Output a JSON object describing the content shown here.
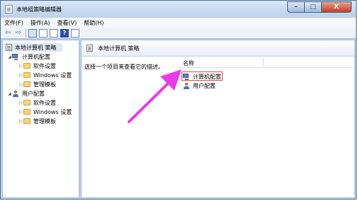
{
  "window": {
    "title": "本地组策略编辑器",
    "controls": {
      "minimize": "–",
      "maximize": "□",
      "close": "X"
    }
  },
  "menu": [
    "文件(F)",
    "操作(A)",
    "查看(V)",
    "帮助(H)"
  ],
  "toolbar": {
    "buttons": [
      "back-arrow-icon",
      "forward-arrow-icon",
      "show-tree-icon",
      "properties-icon",
      "export-icon",
      "help-icon",
      "view-icon"
    ],
    "back_glyph": "⇦",
    "forward_glyph": "⇨",
    "help_glyph": "?"
  },
  "tree": {
    "root": "本地计算机 策略",
    "computer": {
      "label": "计算机配置",
      "children": [
        "软件设置",
        "Windows 设置",
        "管理模板"
      ]
    },
    "user": {
      "label": "用户配置",
      "children": [
        "软件设置",
        "Windows 设置",
        "管理模板"
      ]
    }
  },
  "details": {
    "header_title": "本地计算机 策略",
    "description": "选择一个项目来查看它的描述。",
    "column_name": "名称",
    "items": [
      "计算机配置",
      "用户配置"
    ]
  },
  "colors": {
    "highlight_border": "#e34141",
    "annotation_arrow": "#e83ce8"
  }
}
